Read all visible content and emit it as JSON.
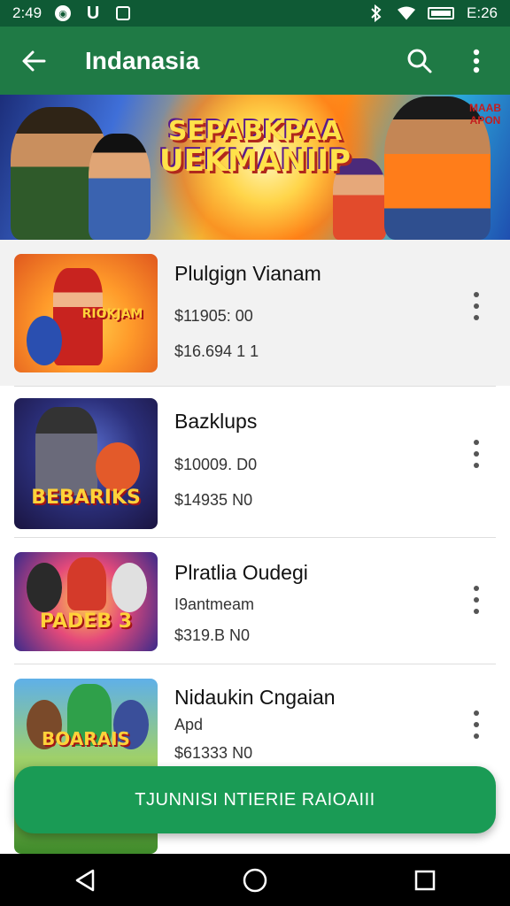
{
  "status_bar": {
    "time": "2:49",
    "right_time": "E:26",
    "icons": [
      "notification-circle-icon",
      "app-u-icon",
      "app-square-icon",
      "bluetooth-icon",
      "wifi-icon",
      "battery-icon"
    ]
  },
  "app_bar": {
    "title": "Indanasia",
    "back_icon": "back-arrow-icon",
    "search_icon": "search-icon",
    "more_icon": "more-vert-icon",
    "background": "#1f7a45"
  },
  "banner": {
    "title_line1": "SEPABKPAA",
    "title_line2": "UEKMANIIP",
    "corner_text_line1": "MAAB",
    "corner_text_line2": "APON"
  },
  "items": [
    {
      "title": "Plulgign Vianam",
      "line1": "$11905: 00",
      "line2": "$16.694 1 1",
      "thumb_label": "RIOKJAM"
    },
    {
      "title": "Bazklups",
      "line1": "$10009. D0",
      "line2": "$14935 N0",
      "thumb_label": "BEBARIKS"
    },
    {
      "title": "Plratlia Oudegi",
      "line1": "I9antmeam",
      "line2": "$319.B N0",
      "thumb_label": "PADEB 3"
    },
    {
      "title": "Nidaukin Cngaian",
      "line1": "Apd",
      "line2": "$61333 N0",
      "thumb_label": "BOARAIS"
    }
  ],
  "cta": {
    "label": "TJUNNISI NTIERIE RAIOAIII",
    "color": "#1a9b55"
  },
  "nav_bar": {
    "back": "nav-back-icon",
    "home": "nav-home-icon",
    "recents": "nav-recents-icon"
  }
}
